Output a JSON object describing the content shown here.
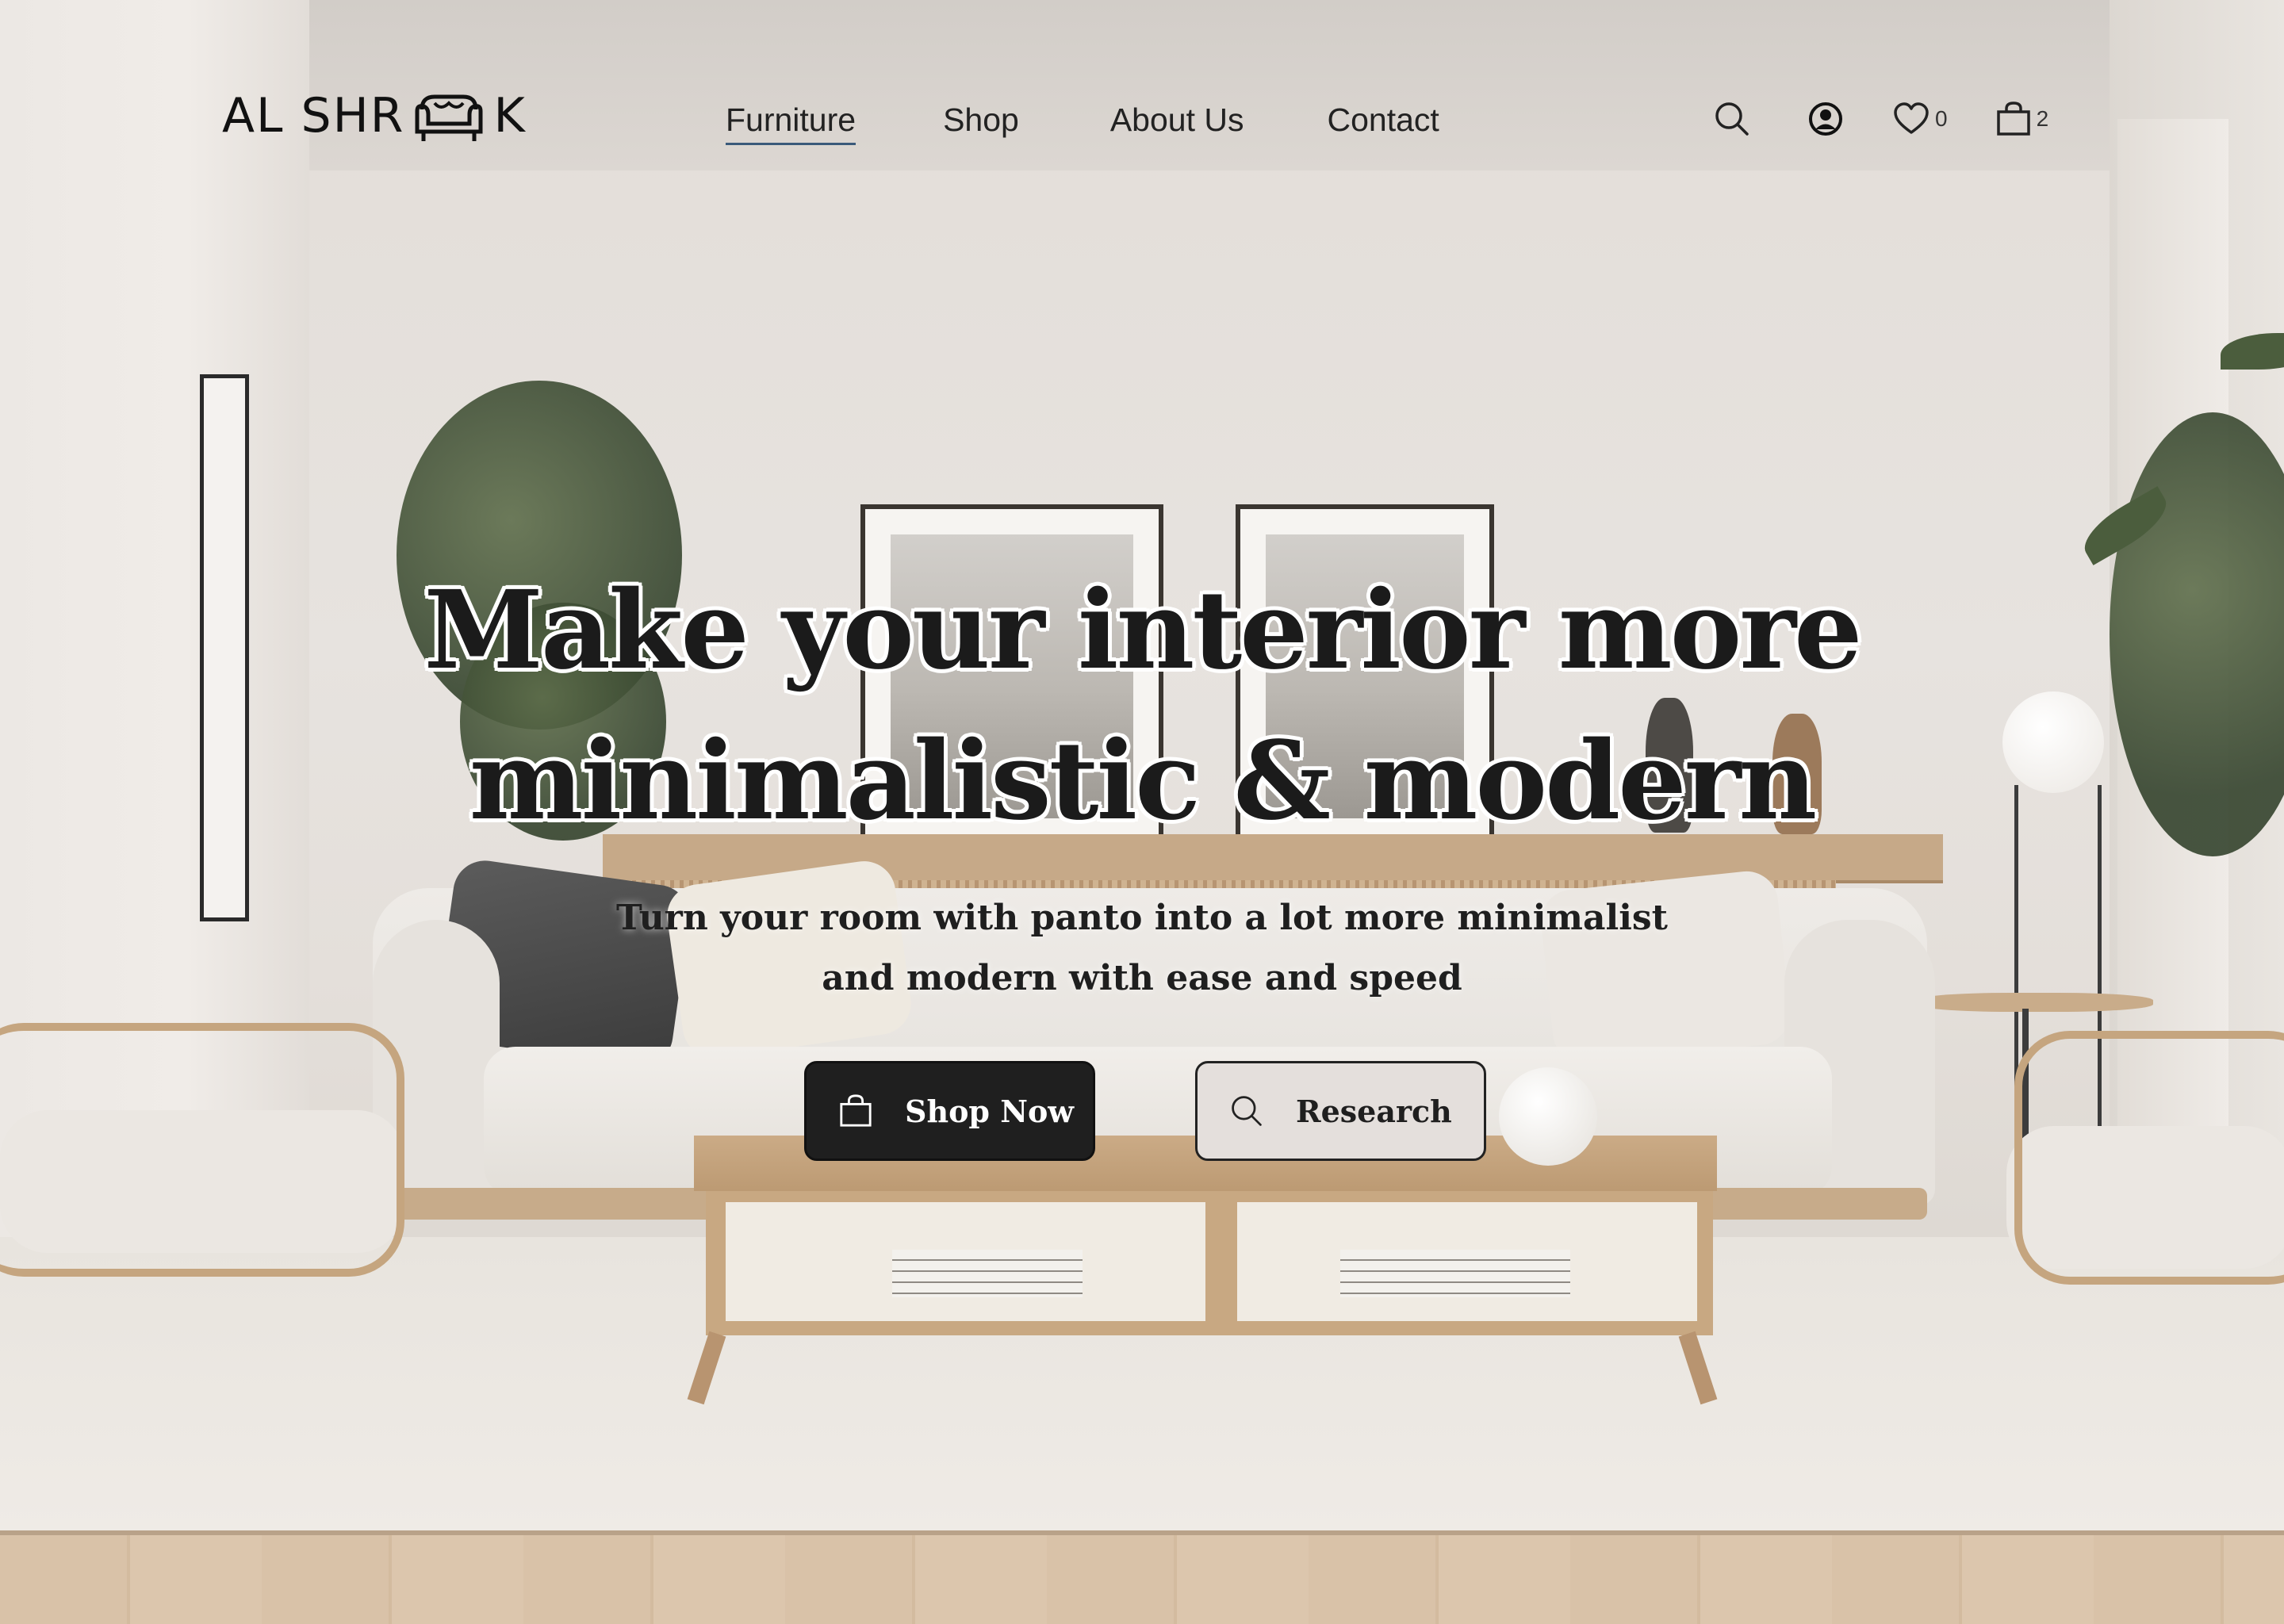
{
  "brand": {
    "logo_text_left": "AL SHR",
    "logo_text_right": "K",
    "logo_icon": "sofa-icon"
  },
  "nav": {
    "links": [
      {
        "label": "Furniture",
        "active": true
      },
      {
        "label": "Shop",
        "active": false
      },
      {
        "label": "About Us",
        "active": false
      },
      {
        "label": "Contact",
        "active": false
      }
    ],
    "icons": {
      "search": "search-icon",
      "account": "user-circle-icon",
      "wishlist": "heart-icon",
      "cart": "bag-icon"
    },
    "wishlist_count": "0",
    "cart_count": "2"
  },
  "hero": {
    "title_line1": "Make your interior more",
    "title_line2": "minimalistic & modern",
    "subtitle_line1": "Turn your room with panto into a lot more minimalist",
    "subtitle_line2": "and modern with ease and speed",
    "primary_button": "Shop Now",
    "secondary_button": "Research"
  },
  "colors": {
    "accent_dark": "#1f1f1f",
    "active_underline": "#3a5a7a",
    "button_light": "#e4dfdc"
  }
}
